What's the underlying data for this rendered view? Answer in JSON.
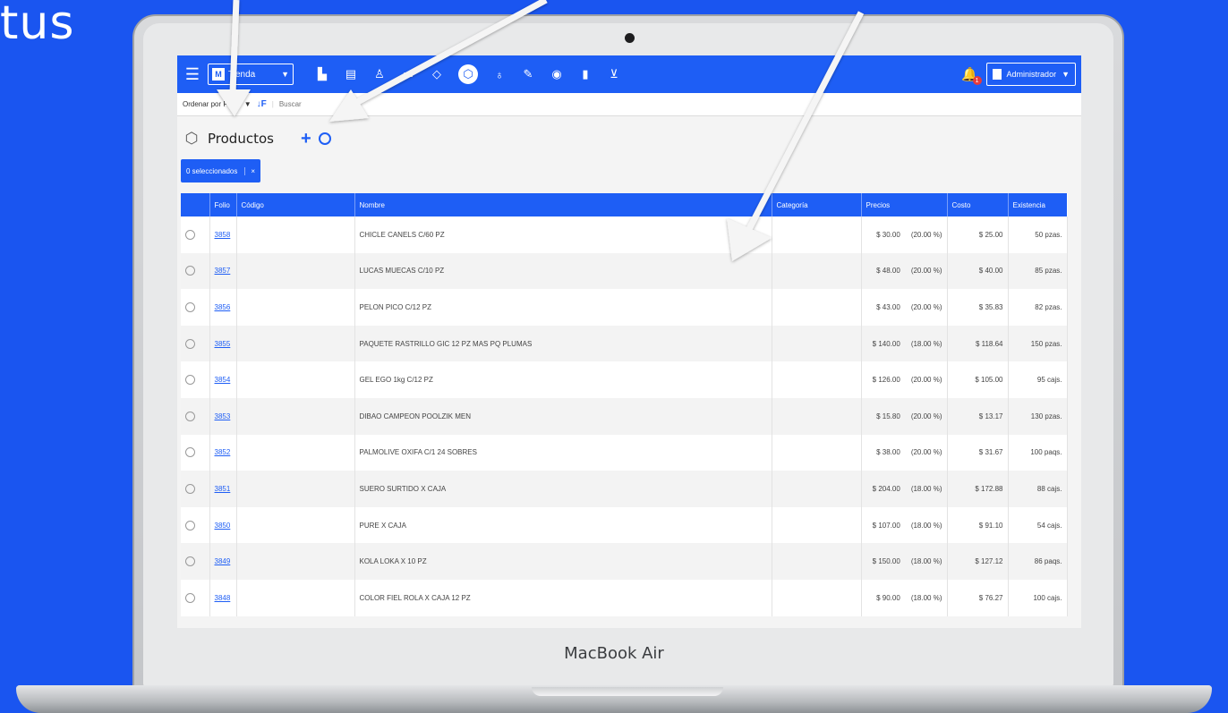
{
  "corner_text": "tus",
  "laptop_label": "MacBook Air",
  "app": {
    "branch": "Tienda",
    "branch_logo": "M",
    "notification_count": "1",
    "user": "Administrador",
    "toolbar_icons": [
      "sales-icon",
      "cash-register-icon",
      "customer-icon",
      "inventory-icon",
      "purchases-icon",
      "products-icon",
      "basket-icon",
      "tag-icon",
      "location-icon",
      "bottle-icon",
      "cart-icon"
    ]
  },
  "subbar": {
    "sort_label": "Ordenar por Folio",
    "sort_caret": "▼",
    "sort_icon": "↓F",
    "search_placeholder": "Buscar"
  },
  "page": {
    "title": "Productos",
    "add": "+",
    "selected_label": "0 seleccionados",
    "selected_close": "×"
  },
  "table": {
    "columns": [
      "",
      "Folio",
      "Código",
      "Nombre",
      "Categoría",
      "Precios",
      "Costo",
      "Existencia"
    ],
    "rows": [
      {
        "folio": "3858",
        "codigo": "",
        "nombre": "CHICLE CANELS C/60 PZ",
        "categoria": "",
        "precio": "$ 30.00",
        "margen": "(20.00 %)",
        "costo": "$ 25.00",
        "existencia": "50 pzas."
      },
      {
        "folio": "3857",
        "codigo": "",
        "nombre": "LUCAS MUECAS C/10 PZ",
        "categoria": "",
        "precio": "$ 48.00",
        "margen": "(20.00 %)",
        "costo": "$ 40.00",
        "existencia": "85 pzas."
      },
      {
        "folio": "3856",
        "codigo": "",
        "nombre": "PELON PICO C/12 PZ",
        "categoria": "",
        "precio": "$ 43.00",
        "margen": "(20.00 %)",
        "costo": "$ 35.83",
        "existencia": "82 pzas."
      },
      {
        "folio": "3855",
        "codigo": "",
        "nombre": "PAQUETE RASTRILLO GIC 12 PZ MAS PQ PLUMAS",
        "categoria": "",
        "precio": "$ 140.00",
        "margen": "(18.00 %)",
        "costo": "$ 118.64",
        "existencia": "150 pzas."
      },
      {
        "folio": "3854",
        "codigo": "",
        "nombre": "GEL EGO 1kg C/12 PZ",
        "categoria": "",
        "precio": "$ 126.00",
        "margen": "(20.00 %)",
        "costo": "$ 105.00",
        "existencia": "95 cajs."
      },
      {
        "folio": "3853",
        "codigo": "",
        "nombre": "DIBAO CAMPEON POOLZIK MEN",
        "categoria": "",
        "precio": "$ 15.80",
        "margen": "(20.00 %)",
        "costo": "$ 13.17",
        "existencia": "130 pzas."
      },
      {
        "folio": "3852",
        "codigo": "",
        "nombre": "PALMOLIVE OXIFA C/1 24 SOBRES",
        "categoria": "",
        "precio": "$ 38.00",
        "margen": "(20.00 %)",
        "costo": "$ 31.67",
        "existencia": "100 paqs."
      },
      {
        "folio": "3851",
        "codigo": "",
        "nombre": "SUERO SURTIDO X CAJA",
        "categoria": "",
        "precio": "$ 204.00",
        "margen": "(18.00 %)",
        "costo": "$ 172.88",
        "existencia": "88 cajs."
      },
      {
        "folio": "3850",
        "codigo": "",
        "nombre": "PURE X CAJA",
        "categoria": "",
        "precio": "$ 107.00",
        "margen": "(18.00 %)",
        "costo": "$ 91.10",
        "existencia": "54 cajs."
      },
      {
        "folio": "3849",
        "codigo": "",
        "nombre": "KOLA LOKA X 10 PZ",
        "categoria": "",
        "precio": "$ 150.00",
        "margen": "(18.00 %)",
        "costo": "$ 127.12",
        "existencia": "86 paqs."
      },
      {
        "folio": "3848",
        "codigo": "",
        "nombre": "COLOR FIEL ROLA X CAJA 12 PZ",
        "categoria": "",
        "precio": "$ 90.00",
        "margen": "(18.00 %)",
        "costo": "$ 76.27",
        "existencia": "100 cajs."
      }
    ]
  },
  "colors": {
    "background": "#1a55f0",
    "app_blue": "#1e5ef5",
    "badge_red": "#e83b3b"
  }
}
